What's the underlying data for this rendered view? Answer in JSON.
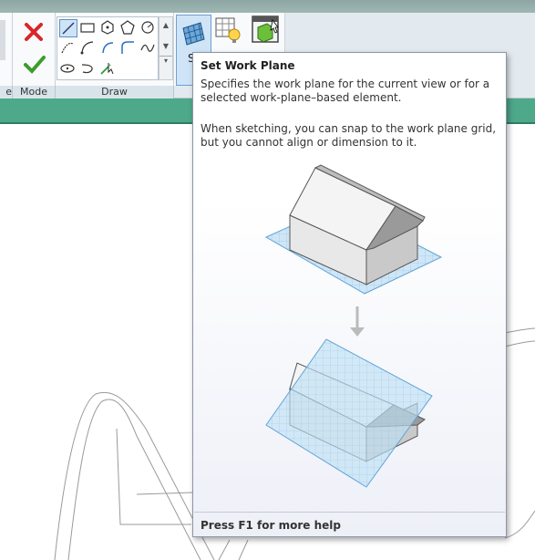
{
  "ribbon": {
    "panels": {
      "partial_label": "e",
      "mode_label": "Mode",
      "draw_label": "Draw"
    },
    "mode_buttons": [
      {
        "icon": "cancel-x-icon",
        "color": "#d9252b"
      },
      {
        "icon": "finish-check-icon",
        "color": "#3c9c2c"
      }
    ],
    "draw_tools": [
      "line-icon",
      "rectangle-icon",
      "inscribed-polygon-icon",
      "circumscribed-polygon-icon",
      "circle-icon",
      "start-end-arc-icon",
      "center-ends-arc-icon",
      "tangent-end-arc-icon",
      "fillet-arc-icon",
      "spline-icon",
      "ellipse-icon",
      "partial-ellipse-icon",
      "pick-lines-icon"
    ],
    "workplane_buttons": {
      "set_partial_label": "S",
      "show_icon": "show-workplane-icon",
      "viewer_icon": "workplane-viewer-icon"
    }
  },
  "tooltip": {
    "title": "Set Work Plane",
    "description": "Specifies the work plane for the current view or for a selected work-plane–based element.",
    "note": "When sketching, you can snap to the work plane grid, but you cannot align or dimension to it.",
    "footer": "Press F1 for more help"
  },
  "colors": {
    "ribbon_bg": "#e3eaef",
    "accent_green": "#4ea88a",
    "plane_blue": "#7fb8e0"
  }
}
